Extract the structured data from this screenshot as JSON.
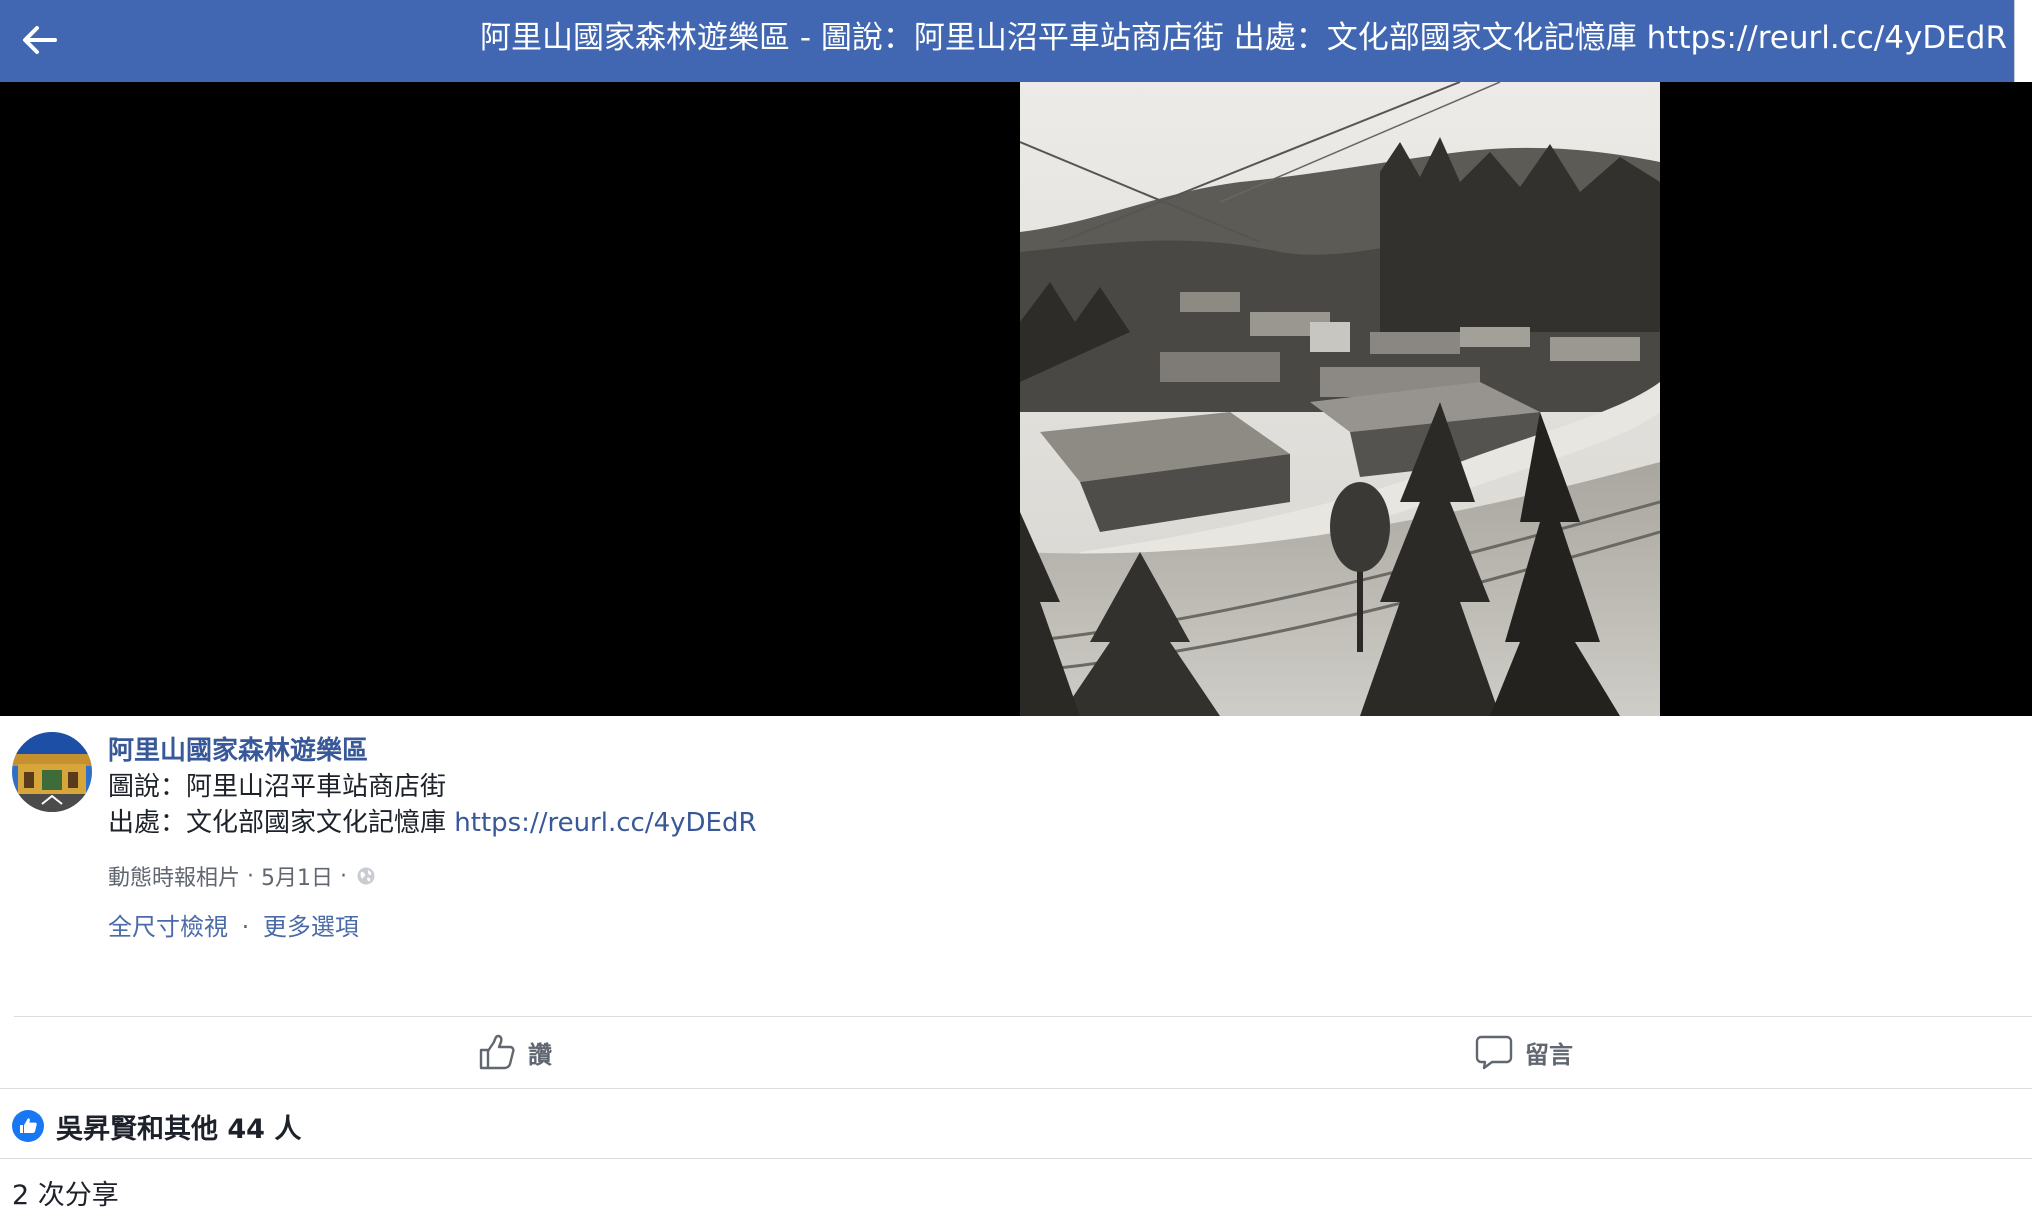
{
  "topbar": {
    "back_icon": "arrow-left-icon",
    "title": "阿里山國家森林遊樂區 - 圖說：阿里山沼平車站商店街 出處：文化部國家文化記憶庫 https://reurl.cc/4yDEdR",
    "background": "#4267b2"
  },
  "post": {
    "page_name": "阿里山國家森林遊樂區",
    "caption_line1": "圖說：阿里山沼平車站商店街",
    "caption_line2_prefix": "出處：文化部國家文化記憶庫 ",
    "caption_link": "https://reurl.cc/4yDEdR",
    "meta": {
      "album": "動態時報相片",
      "separator": "·",
      "date": "5月1日",
      "privacy_icon": "globe-icon"
    },
    "options": {
      "full_size": "全尺寸檢視",
      "separator": "·",
      "more": "更多選項"
    }
  },
  "actions": {
    "like_label": "讚",
    "like_icon": "thumbs-up-icon",
    "comment_label": "留言",
    "comment_icon": "comment-bubble-icon"
  },
  "reactions": {
    "icon": "like-badge-icon",
    "text": "吳昇賢和其他 44 人",
    "accent": "#1877f2"
  },
  "shares": {
    "text": "2 次分享"
  },
  "colors": {
    "link": "#385898",
    "meta_text": "#616770",
    "body_text": "#1d2129"
  }
}
